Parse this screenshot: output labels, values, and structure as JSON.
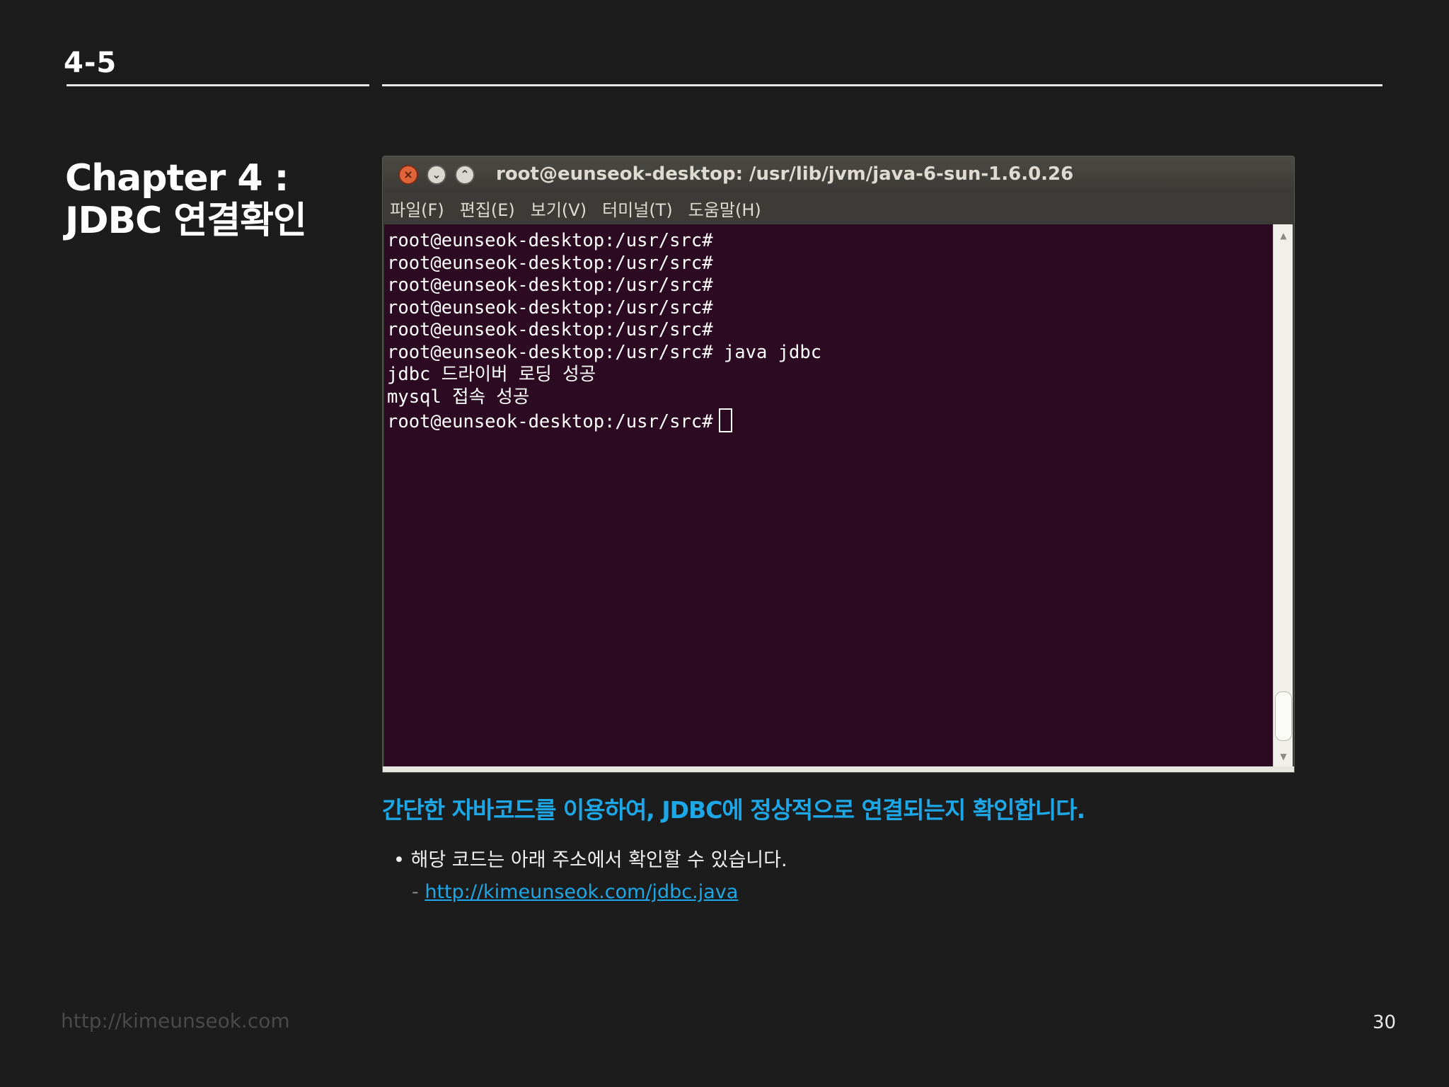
{
  "slide": {
    "section": "4-5",
    "title_line1": "Chapter 4 :",
    "title_line2": "JDBC 연결확인",
    "caption": "간단한 자바코드를 이용하여, JDBC에 정상적으로 연결되는지 확인합니다.",
    "bullet": "• 해당 코드는 아래 주소에서 확인할 수 있습니다.",
    "sub_prefix": "- ",
    "link": "http://kimeunseok.com/jdbc.java",
    "footer_url": "http://kimeunseok.com",
    "page_number": "30"
  },
  "terminal": {
    "window_title": "root@eunseok-desktop: /usr/lib/jvm/java-6-sun-1.6.0.26",
    "close_glyph": "×",
    "min_glyph": "⌄",
    "max_glyph": "⌃",
    "menu": [
      "파일(F)",
      "편집(E)",
      "보기(V)",
      "터미널(T)",
      "도움말(H)"
    ],
    "lines": [
      "root@eunseok-desktop:/usr/src#",
      "root@eunseok-desktop:/usr/src#",
      "root@eunseok-desktop:/usr/src#",
      "root@eunseok-desktop:/usr/src#",
      "root@eunseok-desktop:/usr/src#",
      "root@eunseok-desktop:/usr/src# java jdbc",
      "jdbc 드라이버 로딩 성공",
      "mysql 접속 성공"
    ],
    "prompt_last": "root@eunseok-desktop:/usr/src#",
    "scroll_up_glyph": "▲",
    "scroll_down_glyph": "▼"
  },
  "colors": {
    "background": "#1c1c1c",
    "accent": "#1ea7e6",
    "terminal_bg": "#2c0a22",
    "titlebar": "#3c3b37"
  }
}
